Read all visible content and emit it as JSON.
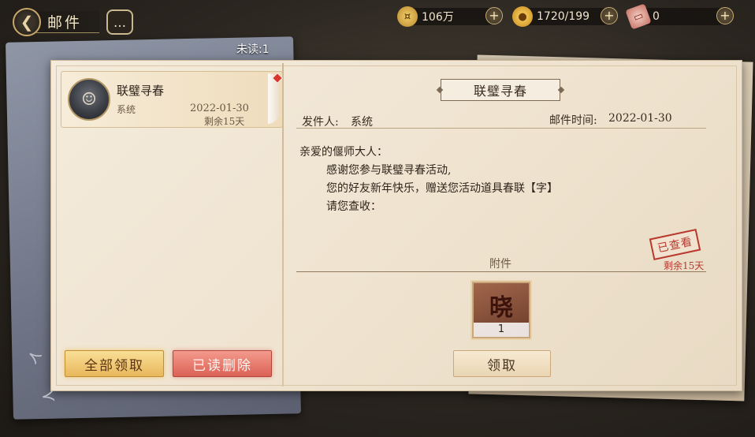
{
  "header": {
    "title": "邮件",
    "back_icon": "back-arrow-icon",
    "chat_icon": "chat-icon"
  },
  "resources": [
    {
      "name": "coin",
      "value": "106万"
    },
    {
      "name": "gold",
      "value": "1720/199"
    },
    {
      "name": "ticket",
      "value": "0"
    }
  ],
  "unread": "未读:1",
  "mail_list": [
    {
      "title": "联璧寻春",
      "from": "系统",
      "date": "2022-01-30",
      "remain": "剩余15天"
    }
  ],
  "left_buttons": {
    "claim_all": "全部领取",
    "delete_read": "已读删除"
  },
  "detail": {
    "title": "联璧寻春",
    "sender_label": "发件人:",
    "sender_value": "系统",
    "time_label": "邮件时间:",
    "time_value": "2022-01-30",
    "body": [
      "亲爱的偃师大人：",
      "感谢您参与联璧寻春活动,",
      "您的好友新年快乐，赠送您活动道具春联【字】",
      "请您查收："
    ],
    "stamp": "已查看",
    "stamp_remain": "剩余15天",
    "attach_label": "附件",
    "item_glyph": "晓",
    "item_count": "1",
    "take_button": "领取"
  },
  "colors": {
    "accent_gold": "#e8b75c",
    "accent_red": "#db6255",
    "paper": "#f4ebdc"
  }
}
